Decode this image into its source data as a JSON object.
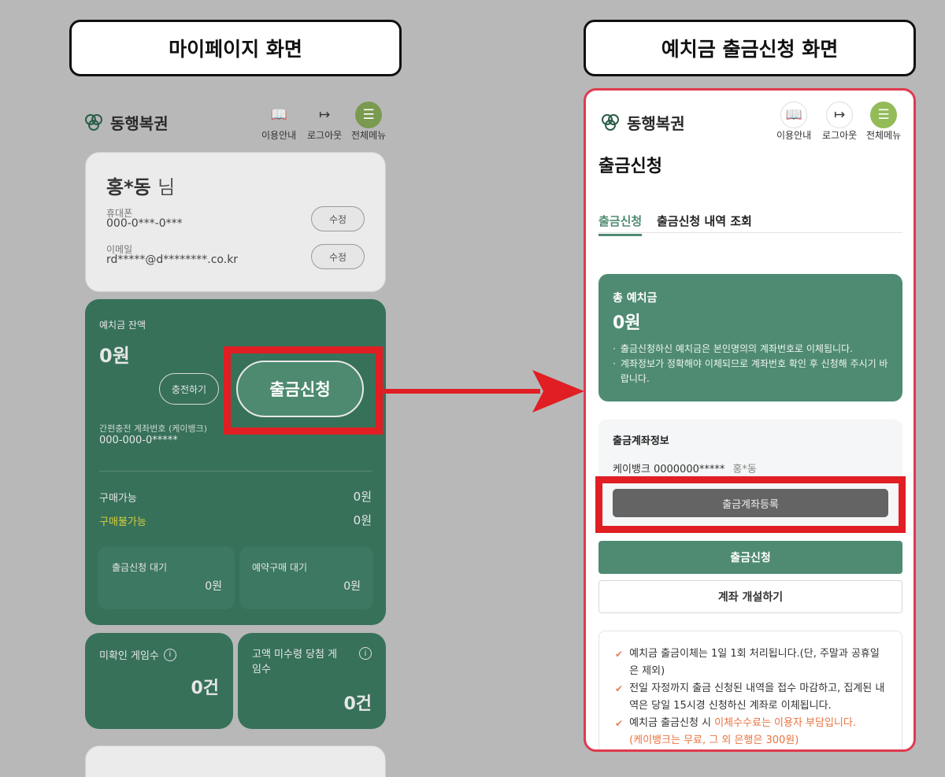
{
  "captions": {
    "left": "마이페이지 화면",
    "right": "예치금 출금신청 화면"
  },
  "brand": {
    "name": "동행복권"
  },
  "header_buttons": {
    "guide": "이용안내",
    "logout": "로그아웃",
    "menu": "전체메뉴"
  },
  "mypage": {
    "user_name": "홍*동",
    "honorific": "님",
    "phone_label": "휴대폰",
    "phone_value": "000-0***-0***",
    "email_label": "이메일",
    "email_value": "rd*****@d********.co.kr",
    "edit_label": "수정",
    "balance_label": "예치금 잔액",
    "balance_value": "0원",
    "charge_button": "충전하기",
    "withdraw_button": "출금신청",
    "account_label": "간편충전 계좌번호 (케이뱅크)",
    "account_value": "000-000-0*****",
    "purchasable_label": "구매가능",
    "purchasable_value": "0원",
    "not_purchasable_label": "구매불가능",
    "not_purchasable_value": "0원",
    "withdraw_wait_label": "출금신청 대기",
    "withdraw_wait_value": "0원",
    "reserve_wait_label": "예약구매 대기",
    "reserve_wait_value": "0원",
    "unchecked_label": "미확인 게임수",
    "unchecked_value": "0건",
    "unclaimed_label": "고액 미수령 당첨 게임수",
    "unclaimed_value": "0건"
  },
  "withdraw": {
    "page_title": "출금신청",
    "tab_apply": "출금신청",
    "tab_history": "출금신청 내역 조회",
    "total_label": "총 예치금",
    "total_value": "0원",
    "notes": [
      "출금신청하신 예치금은 본인명의의 계좌번호로 이체됩니다.",
      "계좌정보가 정확해야 이체되므로 계좌번호 확인 후 신청해 주시기 바랍니다."
    ],
    "account_info_title": "출금계좌정보",
    "account_bank_number": "케이뱅크 0000000*****",
    "account_holder": "홍*동",
    "register_button": "출금계좌등록",
    "apply_button": "출금신청",
    "open_account_button": "계좌 개설하기",
    "notice_1": "예치금 출금이체는 1일 1회 처리됩니다.(단, 주말과 공휴일은 제외)",
    "notice_2": "전일 자정까지 출금 신청된 내역을 접수 마감하고, 집계된 내역은 당일 15시경 신청하신 계좌로 이체됩니다.",
    "notice_3_prefix": "예치금 출금신청 시 ",
    "notice_3_highlight": "이체수수료는 이용자 부담입니다.",
    "notice_3_sub": "(케이뱅크는 무료, 그 외 은행은 300원)"
  },
  "colors": {
    "green": "#4f8b72",
    "green_dim": "#37715a",
    "highlight_red": "#e01e23",
    "notice_orange": "#e9723d",
    "yellow_label": "#d6cf3e"
  }
}
